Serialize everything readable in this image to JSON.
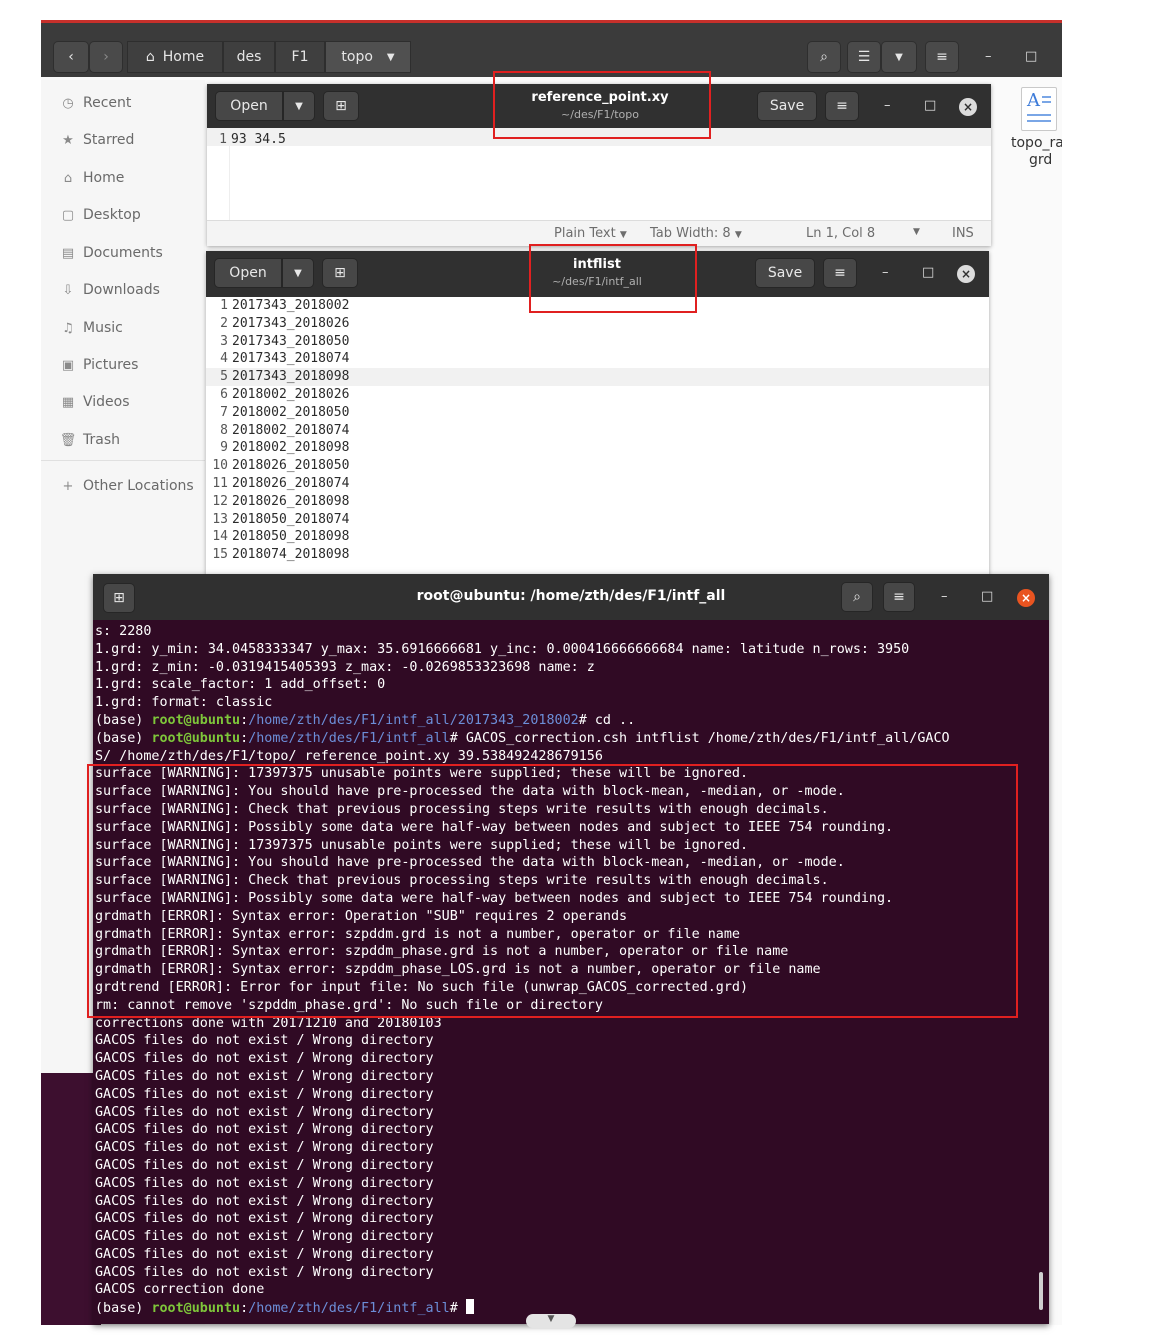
{
  "file_manager": {
    "path": [
      "Home",
      "des",
      "F1",
      "topo"
    ],
    "sidebar": [
      {
        "label": "Recent",
        "icon": "clock-icon"
      },
      {
        "label": "Starred",
        "icon": "star-icon"
      },
      {
        "label": "Home",
        "icon": "home-icon"
      },
      {
        "label": "Desktop",
        "icon": "desktop-icon"
      },
      {
        "label": "Documents",
        "icon": "documents-icon"
      },
      {
        "label": "Downloads",
        "icon": "download-icon"
      },
      {
        "label": "Music",
        "icon": "music-icon"
      },
      {
        "label": "Pictures",
        "icon": "pictures-icon"
      },
      {
        "label": "Videos",
        "icon": "videos-icon"
      },
      {
        "label": "Trash",
        "icon": "trash-icon"
      },
      {
        "label": "Other Locations",
        "icon": "plus-icon"
      }
    ],
    "file_item": {
      "line1": "topo_ra",
      "line2": "grd"
    }
  },
  "editor1": {
    "open_label": "Open",
    "save_label": "Save",
    "title": "reference_point.xy",
    "subtitle": "~/des/F1/topo",
    "lines": [
      {
        "num": "1",
        "text": "93 34.5"
      }
    ],
    "status": {
      "language": "Plain Text",
      "tab_width": "Tab Width: 8",
      "position": "Ln 1, Col 8",
      "mode": "INS"
    }
  },
  "editor2": {
    "open_label": "Open",
    "save_label": "Save",
    "title": "intflist",
    "subtitle": "~/des/F1/intf_all",
    "lines": [
      {
        "num": "1",
        "text": "2017343_2018002"
      },
      {
        "num": "2",
        "text": "2017343_2018026"
      },
      {
        "num": "3",
        "text": "2017343_2018050"
      },
      {
        "num": "4",
        "text": "2017343_2018074"
      },
      {
        "num": "5",
        "text": "2017343_2018098"
      },
      {
        "num": "6",
        "text": "2018002_2018026"
      },
      {
        "num": "7",
        "text": "2018002_2018050"
      },
      {
        "num": "8",
        "text": "2018002_2018074"
      },
      {
        "num": "9",
        "text": "2018002_2018098"
      },
      {
        "num": "10",
        "text": "2018026_2018050"
      },
      {
        "num": "11",
        "text": "2018026_2018074"
      },
      {
        "num": "12",
        "text": "2018026_2018098"
      },
      {
        "num": "13",
        "text": "2018050_2018074"
      },
      {
        "num": "14",
        "text": "2018050_2018098"
      },
      {
        "num": "15",
        "text": "2018074_2018098"
      }
    ]
  },
  "terminal": {
    "title": "root@ubuntu: /home/zth/des/F1/intf_all",
    "lines": [
      {
        "text": "s: 2280"
      },
      {
        "text": "1.grd: y_min: 34.0458333347 y_max: 35.6916666681 y_inc: 0.000416666666684 name: latitude n_rows: 3950"
      },
      {
        "text": "1.grd: z_min: -0.0319415405393 z_max: -0.0269853323698 name: z"
      },
      {
        "text": "1.grd: scale_factor: 1 add_offset: 0"
      },
      {
        "text": "1.grd: format: classic"
      },
      {
        "prompt_pre": "(base) ",
        "user": "root@ubuntu",
        "colon": ":",
        "path": "/home/zth/des/F1/intf_all/2017343_2018002",
        "cmd": "# cd .."
      },
      {
        "prompt_pre": "(base) ",
        "user": "root@ubuntu",
        "colon": ":",
        "path": "/home/zth/des/F1/intf_all",
        "cmd": "# GACOS_correction.csh intflist /home/zth/des/F1/intf_all/GACO"
      },
      {
        "text": "S/ /home/zth/des/F1/topo/ reference_point.xy 39.538492428679156"
      },
      {
        "text": "surface [WARNING]: 17397375 unusable points were supplied; these will be ignored."
      },
      {
        "text": "surface [WARNING]: You should have pre-processed the data with block-mean, -median, or -mode."
      },
      {
        "text": "surface [WARNING]: Check that previous processing steps write results with enough decimals."
      },
      {
        "text": "surface [WARNING]: Possibly some data were half-way between nodes and subject to IEEE 754 rounding."
      },
      {
        "text": "surface [WARNING]: 17397375 unusable points were supplied; these will be ignored."
      },
      {
        "text": "surface [WARNING]: You should have pre-processed the data with block-mean, -median, or -mode."
      },
      {
        "text": "surface [WARNING]: Check that previous processing steps write results with enough decimals."
      },
      {
        "text": "surface [WARNING]: Possibly some data were half-way between nodes and subject to IEEE 754 rounding."
      },
      {
        "text": "grdmath [ERROR]: Syntax error: Operation \"SUB\" requires 2 operands"
      },
      {
        "text": "grdmath [ERROR]: Syntax error: szpddm.grd is not a number, operator or file name"
      },
      {
        "text": "grdmath [ERROR]: Syntax error: szpddm_phase.grd is not a number, operator or file name"
      },
      {
        "text": "grdmath [ERROR]: Syntax error: szpddm_phase_LOS.grd is not a number, operator or file name"
      },
      {
        "text": "grdtrend [ERROR]: Error for input file: No such file (unwrap_GACOS_corrected.grd)"
      },
      {
        "text": "rm: cannot remove 'szpddm_phase.grd': No such file or directory"
      },
      {
        "text": "corrections done with 20171210 and 20180103"
      },
      {
        "text": "GACOS files do not exist / Wrong directory"
      },
      {
        "text": "GACOS files do not exist / Wrong directory"
      },
      {
        "text": "GACOS files do not exist / Wrong directory"
      },
      {
        "text": "GACOS files do not exist / Wrong directory"
      },
      {
        "text": "GACOS files do not exist / Wrong directory"
      },
      {
        "text": "GACOS files do not exist / Wrong directory"
      },
      {
        "text": "GACOS files do not exist / Wrong directory"
      },
      {
        "text": "GACOS files do not exist / Wrong directory"
      },
      {
        "text": "GACOS files do not exist / Wrong directory"
      },
      {
        "text": "GACOS files do not exist / Wrong directory"
      },
      {
        "text": "GACOS files do not exist / Wrong directory"
      },
      {
        "text": "GACOS files do not exist / Wrong directory"
      },
      {
        "text": "GACOS files do not exist / Wrong directory"
      },
      {
        "text": "GACOS files do not exist / Wrong directory"
      },
      {
        "text": "GACOS correction done"
      },
      {
        "prompt_pre": "(base) ",
        "user": "root@ubuntu",
        "colon": ":",
        "path": "/home/zth/des/F1/intf_all",
        "cmd": "# ",
        "cursor": true
      }
    ]
  },
  "colors": {
    "terminal_bg": "#300a24",
    "prompt_user": "#7ec63a",
    "prompt_path": "#6c8ed8",
    "highlight_box": "#e02020"
  }
}
